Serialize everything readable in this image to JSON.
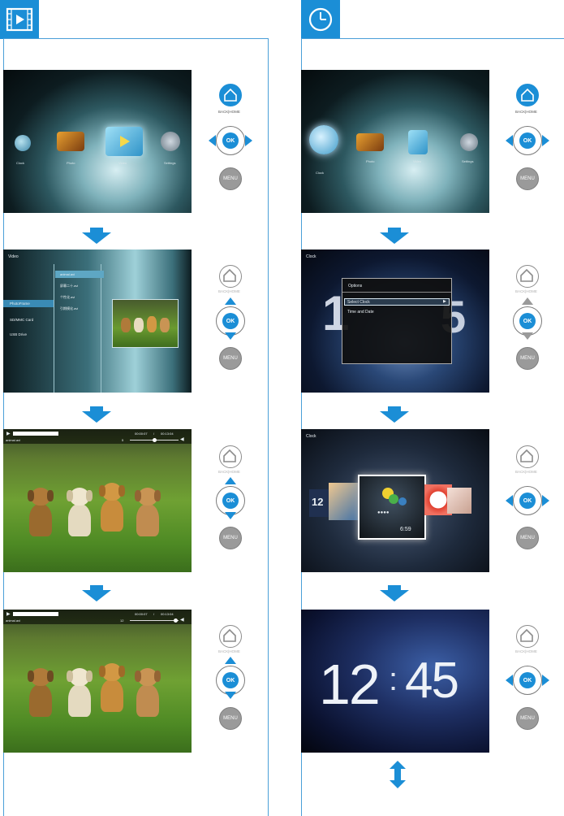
{
  "home_menu": {
    "items": [
      "Clock",
      "Photo",
      "Video",
      "Settings"
    ]
  },
  "video_browser": {
    "title": "Video",
    "sources": [
      "PhotoFrame",
      "SD/MMC Card",
      "USB Drive"
    ],
    "files": [
      "animal.avi",
      "屏幕二十.avi",
      "个性化.avi",
      "引期模化.avi"
    ]
  },
  "player": {
    "filename": "animal.avi",
    "time_elapsed": "00:00:07",
    "time_separator": "/",
    "time_total": "00:13:04",
    "volume_a": "5",
    "volume_b": "12"
  },
  "clock_menu": {
    "title": "Clock",
    "header": "Options",
    "items": [
      "Select Clock",
      "Time and Date"
    ]
  },
  "clock_selector": {
    "title": "Clock",
    "preview_left": "12",
    "preview_center": "6:59"
  },
  "big_clock": {
    "hours": "12",
    "separator": ":",
    "minutes": "45"
  },
  "remote": {
    "backhome_label": "BACK|HOME",
    "ok_label": "OK",
    "menu_label": "MENU"
  },
  "colors": {
    "accent": "#1b8ed6",
    "frame": "#4a9fd8"
  },
  "icons": [
    "video-icon",
    "clock-icon",
    "home-icon",
    "arrow-down-icon",
    "double-arrow-icon"
  ]
}
